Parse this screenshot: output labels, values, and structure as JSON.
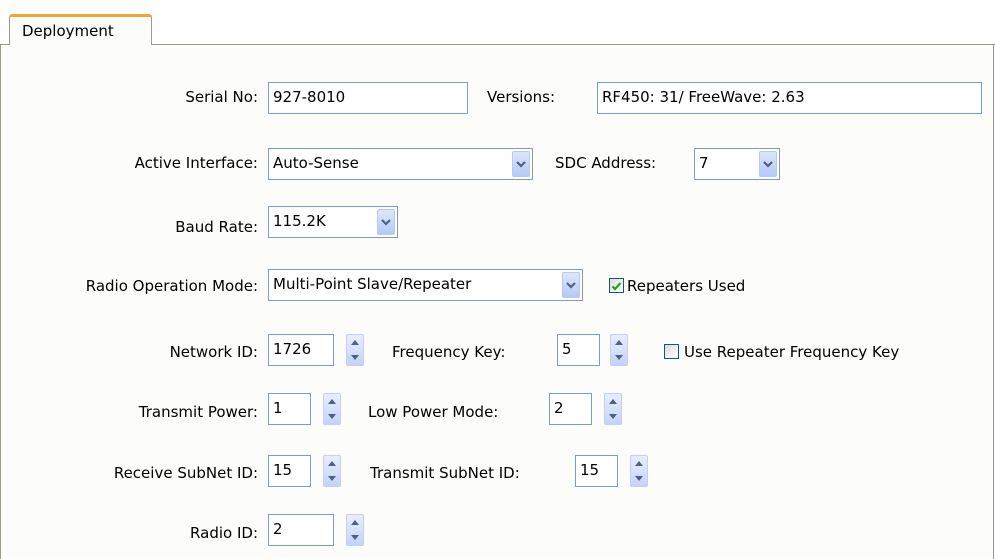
{
  "tab": {
    "label": "Deployment"
  },
  "serial": {
    "label": "Serial No:",
    "value": "927-8010"
  },
  "versions": {
    "label": "Versions:",
    "value": "RF450: 31/ FreeWave: 2.63"
  },
  "active_interface": {
    "label": "Active Interface:",
    "value": "Auto-Sense"
  },
  "sdc_address": {
    "label": "SDC Address:",
    "value": "7"
  },
  "baud_rate": {
    "label": "Baud Rate:",
    "value": "115.2K"
  },
  "radio_mode": {
    "label": "Radio Operation Mode:",
    "value": "Multi-Point Slave/Repeater"
  },
  "repeaters_used": {
    "label": "Repeaters Used",
    "checked": true
  },
  "network_id": {
    "label": "Network ID:",
    "value": "1726"
  },
  "frequency_key": {
    "label": "Frequency Key:",
    "value": "5"
  },
  "use_repeater_freq": {
    "label": "Use Repeater Frequency Key",
    "checked": false
  },
  "transmit_power": {
    "label": "Transmit Power:",
    "value": "1"
  },
  "low_power_mode": {
    "label": "Low Power Mode:",
    "value": "2"
  },
  "receive_subnet": {
    "label": "Receive SubNet ID:",
    "value": "15"
  },
  "transmit_subnet": {
    "label": "Transmit SubNet ID:",
    "value": "15"
  },
  "radio_id": {
    "label": "Radio ID:",
    "value": "2"
  },
  "icons": {
    "dropdown": "chevron-down-icon",
    "spinner": "spin-up-down-icon",
    "check": "checkmark-icon"
  },
  "colors": {
    "tab_accent": "#f1a636",
    "check_green": "#21a121",
    "field_border": "#7f9db9"
  }
}
